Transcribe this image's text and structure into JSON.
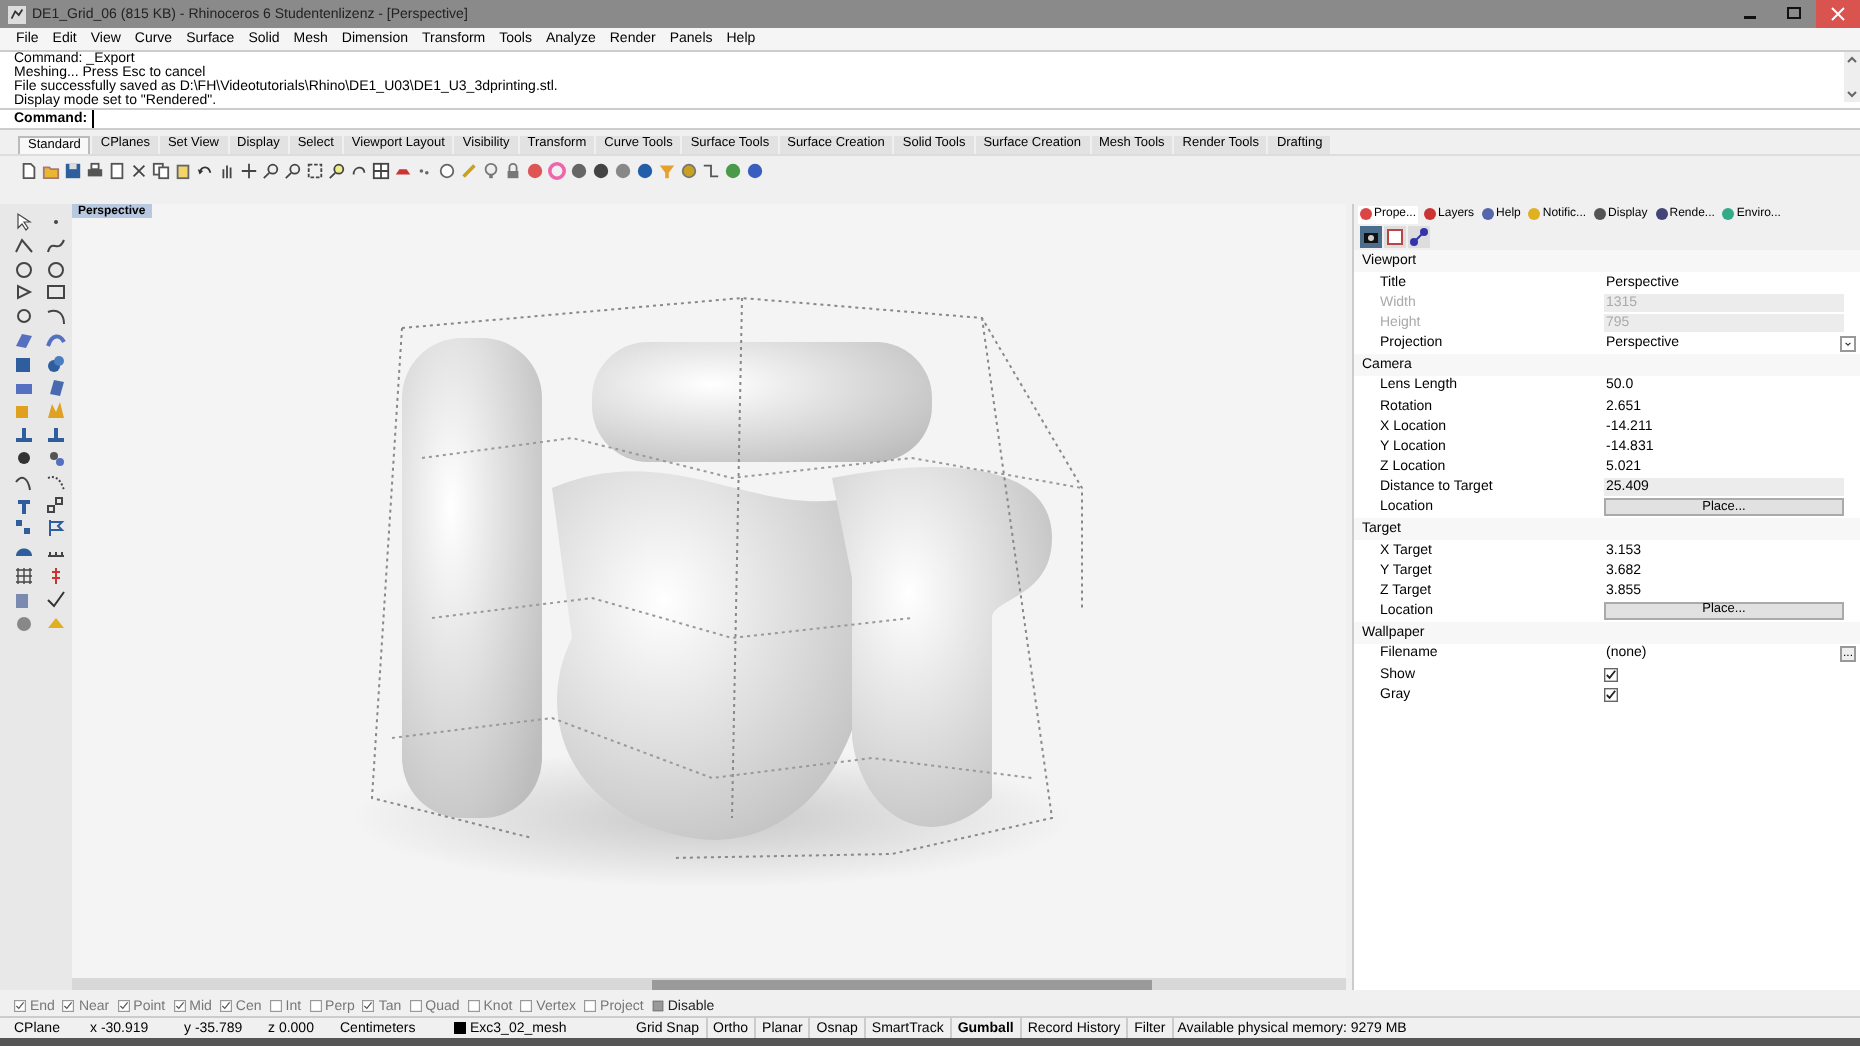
{
  "window": {
    "title": "DE1_Grid_06 (815 KB) - Rhinoceros 6 Studentenlizenz - [Perspective]"
  },
  "menu": [
    "File",
    "Edit",
    "View",
    "Curve",
    "Surface",
    "Solid",
    "Mesh",
    "Dimension",
    "Transform",
    "Tools",
    "Analyze",
    "Render",
    "Panels",
    "Help"
  ],
  "command_history": [
    "Command: _Export",
    "Meshing... Press Esc to cancel",
    "File successfully saved as D:\\FH\\Videotutorials\\Rhino\\DE1_U03\\DE1_U3_3dprinting.stl.",
    "Display mode set to \"Rendered\"."
  ],
  "command_prompt": "Command:",
  "toolbar_tabs": [
    {
      "label": "Standard",
      "selected": true
    },
    {
      "label": "CPlanes",
      "selected": false
    },
    {
      "label": "Set View",
      "selected": false
    },
    {
      "label": "Display",
      "selected": false
    },
    {
      "label": "Select",
      "selected": false
    },
    {
      "label": "Viewport Layout",
      "selected": false
    },
    {
      "label": "Visibility",
      "selected": false
    },
    {
      "label": "Transform",
      "selected": false
    },
    {
      "label": "Curve Tools",
      "selected": false
    },
    {
      "label": "Surface Tools",
      "selected": false
    },
    {
      "label": "Surface Creation",
      "selected": false
    },
    {
      "label": "Solid Tools",
      "selected": false
    },
    {
      "label": "Surface Creation",
      "selected": false
    },
    {
      "label": "Mesh Tools",
      "selected": false
    },
    {
      "label": "Render Tools",
      "selected": false
    },
    {
      "label": "Drafting",
      "selected": false
    }
  ],
  "viewport": {
    "title": "Perspective"
  },
  "panel_tabs": [
    {
      "label": "Prope...",
      "selected": true
    },
    {
      "label": "Layers",
      "selected": false
    },
    {
      "label": "Help",
      "selected": false
    },
    {
      "label": "Notific...",
      "selected": false
    },
    {
      "label": "Display",
      "selected": false
    },
    {
      "label": "Rende...",
      "selected": false
    },
    {
      "label": "Enviro...",
      "selected": false
    }
  ],
  "property_sections": [
    {
      "title": "Viewport",
      "rows": [
        {
          "label": "Title",
          "value": "Perspective",
          "kind": "text"
        },
        {
          "label": "Width",
          "value": "1315",
          "kind": "readonly"
        },
        {
          "label": "Height",
          "value": "795",
          "kind": "readonly"
        },
        {
          "label": "Projection",
          "value": "Perspective",
          "kind": "dropdown"
        }
      ]
    },
    {
      "title": "Camera",
      "rows": [
        {
          "label": "Lens Length",
          "value": "50.0",
          "kind": "text"
        },
        {
          "label": "Rotation",
          "value": "2.651",
          "kind": "text"
        },
        {
          "label": "X Location",
          "value": "-14.211",
          "kind": "text"
        },
        {
          "label": "Y Location",
          "value": "-14.831",
          "kind": "text"
        },
        {
          "label": "Z Location",
          "value": "5.021",
          "kind": "text"
        },
        {
          "label": "Distance to Target",
          "value": "25.409",
          "kind": "shaded"
        },
        {
          "label": "Location",
          "value": "Place...",
          "kind": "button"
        }
      ]
    },
    {
      "title": "Target",
      "rows": [
        {
          "label": "X Target",
          "value": "3.153",
          "kind": "text"
        },
        {
          "label": "Y Target",
          "value": "3.682",
          "kind": "text"
        },
        {
          "label": "Z Target",
          "value": "3.855",
          "kind": "text"
        },
        {
          "label": "Location",
          "value": "Place...",
          "kind": "button"
        }
      ]
    },
    {
      "title": "Wallpaper",
      "rows": [
        {
          "label": "Filename",
          "value": "(none)",
          "kind": "file",
          "browse": "..."
        },
        {
          "label": "Show",
          "kind": "checkbox",
          "checked": true
        },
        {
          "label": "Gray",
          "kind": "checkbox",
          "checked": true
        }
      ]
    }
  ],
  "osnaps": [
    {
      "label": "End",
      "checked": true
    },
    {
      "label": "Near",
      "checked": true
    },
    {
      "label": "Point",
      "checked": true
    },
    {
      "label": "Mid",
      "checked": true
    },
    {
      "label": "Cen",
      "checked": true
    },
    {
      "label": "Int",
      "checked": false
    },
    {
      "label": "Perp",
      "checked": false
    },
    {
      "label": "Tan",
      "checked": true
    },
    {
      "label": "Quad",
      "checked": false
    },
    {
      "label": "Knot",
      "checked": false
    },
    {
      "label": "Vertex",
      "checked": false
    },
    {
      "label": "Project",
      "checked": false
    },
    {
      "label": "Disable",
      "checked": false,
      "kind": "toggle"
    }
  ],
  "status_bar": {
    "cplane": "CPlane",
    "x": "x -30.919",
    "y": "y -35.789",
    "z": "z 0.000",
    "units": "Centimeters",
    "layer": {
      "name": "Exc3_02_mesh",
      "color": "#000000"
    },
    "toggles": [
      {
        "label": "Grid Snap",
        "on": false
      },
      {
        "label": "Ortho",
        "on": false
      },
      {
        "label": "Planar",
        "on": false
      },
      {
        "label": "Osnap",
        "on": false
      },
      {
        "label": "SmartTrack",
        "on": false
      },
      {
        "label": "Gumball",
        "on": true
      },
      {
        "label": "Record History",
        "on": false
      },
      {
        "label": "Filter",
        "on": false
      }
    ],
    "memory": "Available physical memory: 9279 MB"
  }
}
